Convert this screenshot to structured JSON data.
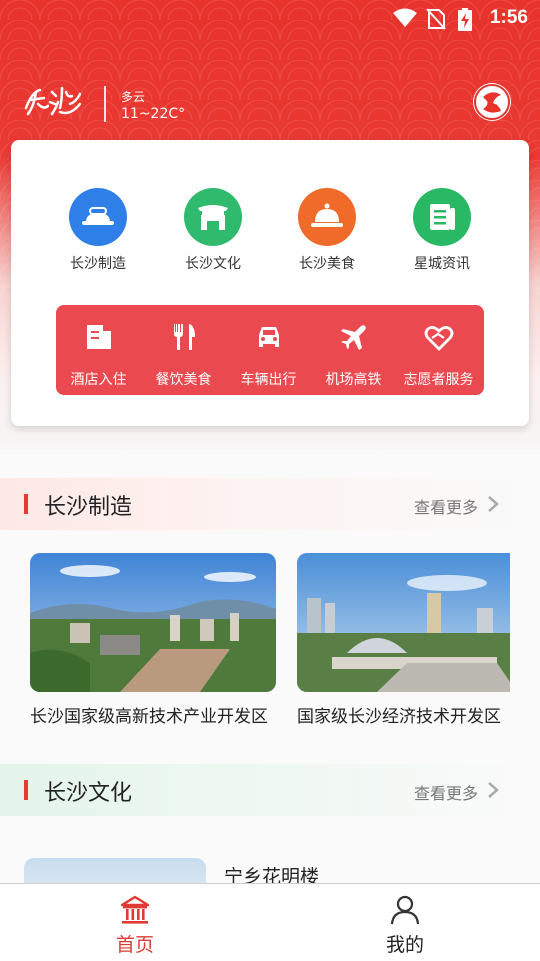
{
  "status_bar": {
    "time": "1:56"
  },
  "header": {
    "city_logo_text": "长沙",
    "weather": {
      "desc": "多云",
      "temp": "11~22C°"
    }
  },
  "categories": [
    {
      "label": "长沙制造",
      "icon": "factory-icon",
      "color": "#2f7fe8"
    },
    {
      "label": "长沙文化",
      "icon": "gate-icon",
      "color": "#2fba6e"
    },
    {
      "label": "长沙美食",
      "icon": "food-cloche-icon",
      "color": "#f06a2a"
    },
    {
      "label": "星城资讯",
      "icon": "news-icon",
      "color": "#29b864"
    }
  ],
  "services": [
    {
      "label": "酒店入住",
      "icon": "hotel-icon"
    },
    {
      "label": "餐饮美食",
      "icon": "fork-knife-icon"
    },
    {
      "label": "车辆出行",
      "icon": "car-icon"
    },
    {
      "label": "机场高铁",
      "icon": "plane-icon"
    },
    {
      "label": "志愿者服务",
      "icon": "heart-hand-icon"
    }
  ],
  "sections": [
    {
      "title": "长沙制造",
      "more": "查看更多",
      "items": [
        {
          "title": "长沙国家级高新技术产业开发区"
        },
        {
          "title": "国家级长沙经济技术开发区"
        }
      ]
    },
    {
      "title": "长沙文化",
      "more": "查看更多",
      "items": [
        {
          "title": "宁乡花明楼"
        }
      ]
    }
  ],
  "tabbar": [
    {
      "label": "首页",
      "icon": "home-bank-icon",
      "active": true,
      "color": "#e03a34"
    },
    {
      "label": "我的",
      "icon": "user-icon",
      "active": false,
      "color": "#222222"
    }
  ]
}
